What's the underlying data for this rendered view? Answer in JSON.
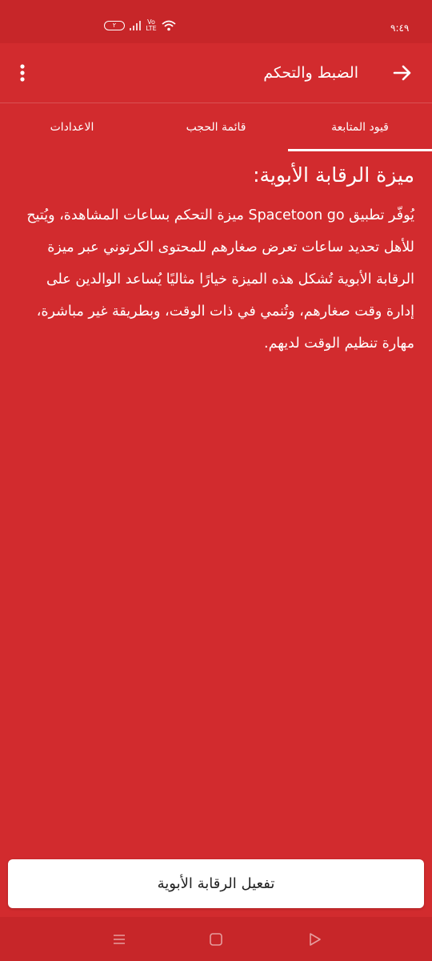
{
  "status_bar": {
    "time": "٩:٤٩",
    "battery_level": "٢",
    "network_label": "Vo LTE",
    "icons": [
      "battery-icon",
      "signal-icon",
      "lte-icon",
      "wifi-icon"
    ]
  },
  "app_bar": {
    "title": "الضبط والتحكم",
    "back_icon": "arrow-right-icon",
    "menu_icon": "more-vertical-icon"
  },
  "tabs": [
    {
      "label": "قيود المتابعة",
      "active": true
    },
    {
      "label": "قائمة الحجب",
      "active": false
    },
    {
      "label": "الاعدادات",
      "active": false
    }
  ],
  "content": {
    "heading": "ميزة الرقابة الأبوية:",
    "body": "يُوفّر تطبيق Spacetoon go ميزة التحكم بساعات المشاهدة، ويُتيح للأهل تحديد ساعات تعرض صغارهم للمحتوى الكرتوني عبر ميزة الرقابة الأبوية تُشكل هذه الميزة خيارًا مثاليًا يُساعد الوالدين على إدارة وقت صغارهم، وتُنمي في ذات الوقت، وبطريقة غير مباشرة، مهارة تنظيم الوقت لديهم."
  },
  "action": {
    "activate_label": "تفعيل الرقابة الأبوية"
  },
  "nav": {
    "icons": [
      "recents-icon",
      "home-icon",
      "back-triangle-icon"
    ]
  },
  "colors": {
    "background": "#d22b2e",
    "status_bar": "#c72629",
    "button": "#ffffff"
  }
}
